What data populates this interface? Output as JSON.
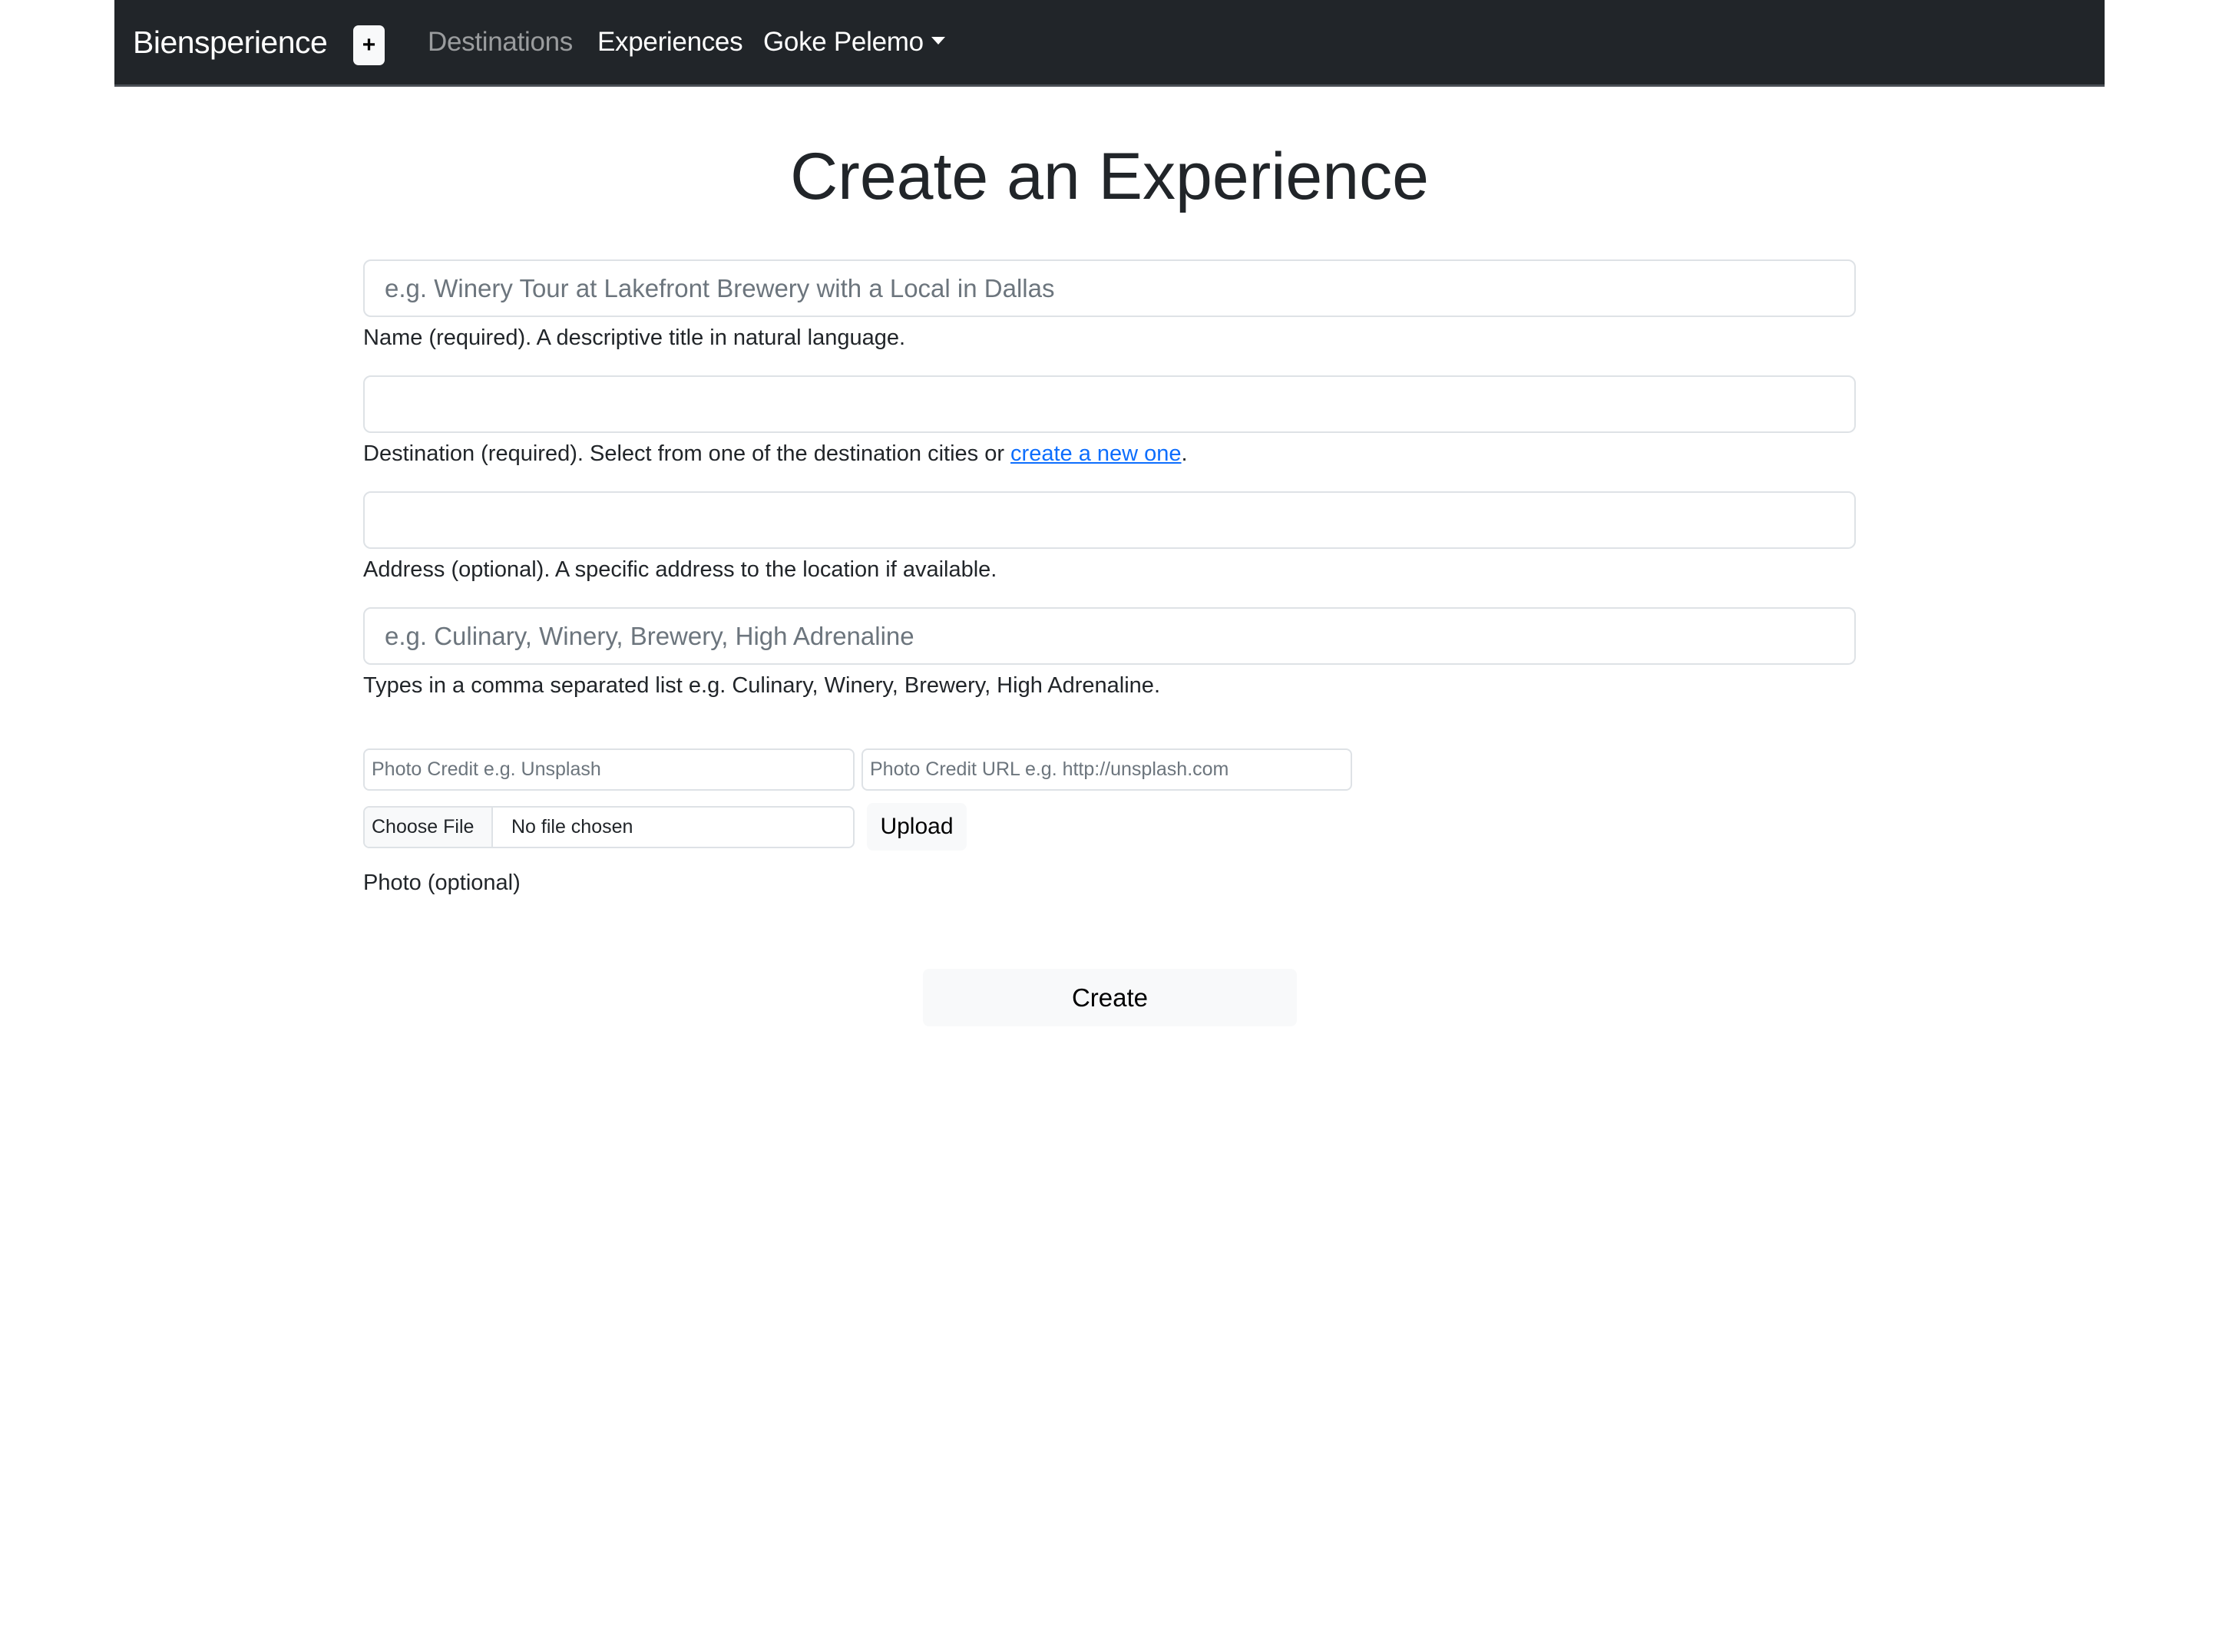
{
  "navbar": {
    "brand": "Biensperience",
    "add_button_label": "+",
    "links": [
      {
        "label": "Destinations",
        "active": false
      },
      {
        "label": "Experiences",
        "active": true
      }
    ],
    "user_menu": {
      "label": "Goke Pelemo",
      "icon": "caret-down-icon"
    }
  },
  "page": {
    "title": "Create an Experience"
  },
  "form": {
    "name": {
      "value": "",
      "placeholder": "e.g. Winery Tour at Lakefront Brewery with a Local in Dallas",
      "help": "Name (required). A descriptive title in natural language."
    },
    "destination": {
      "value": "",
      "placeholder": "",
      "help_prefix": "Destination (required). Select from one of the destination cities or ",
      "help_link": "create a new one",
      "help_suffix": "."
    },
    "address": {
      "value": "",
      "placeholder": "",
      "help": "Address (optional). A specific address to the location if available."
    },
    "types": {
      "value": "",
      "placeholder": "e.g. Culinary, Winery, Brewery, High Adrenaline",
      "help": "Types in a comma separated list e.g. Culinary, Winery, Brewery, High Adrenaline."
    },
    "photo": {
      "credit_placeholder": "Photo Credit e.g. Unsplash",
      "credit_url_placeholder": "Photo Credit URL e.g. http://unsplash.com",
      "choose_file_label": "Choose File",
      "file_status": "No file chosen",
      "upload_label": "Upload",
      "label": "Photo (optional)"
    },
    "submit_label": "Create"
  },
  "colors": {
    "navbar_bg": "#212529",
    "link": "#0d6efd",
    "button_light": "#f8f9fa"
  }
}
